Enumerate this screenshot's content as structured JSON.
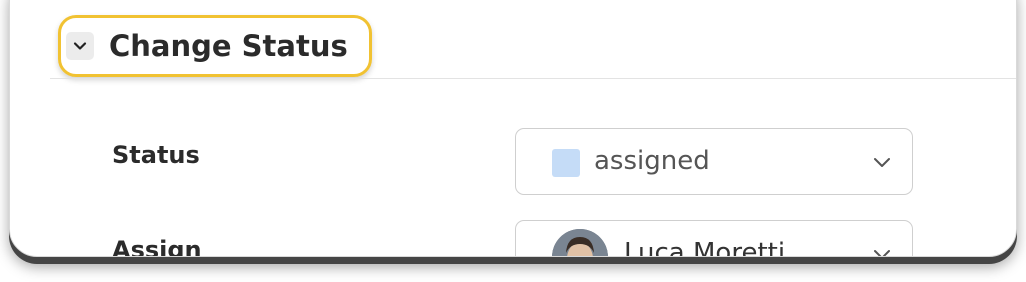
{
  "section": {
    "title": "Change Status",
    "highlight_color": "#f1c232",
    "toggle_icon": "chevron-down-icon"
  },
  "fields": {
    "status": {
      "label": "Status",
      "value": "assigned",
      "swatch_color": "#c5dcf7",
      "dropdown_icon": "chevron-down-icon"
    },
    "assign": {
      "label": "Assign",
      "value": "Luca Moretti",
      "avatar_icon": "avatar",
      "dropdown_icon": "chevron-down-icon"
    }
  }
}
